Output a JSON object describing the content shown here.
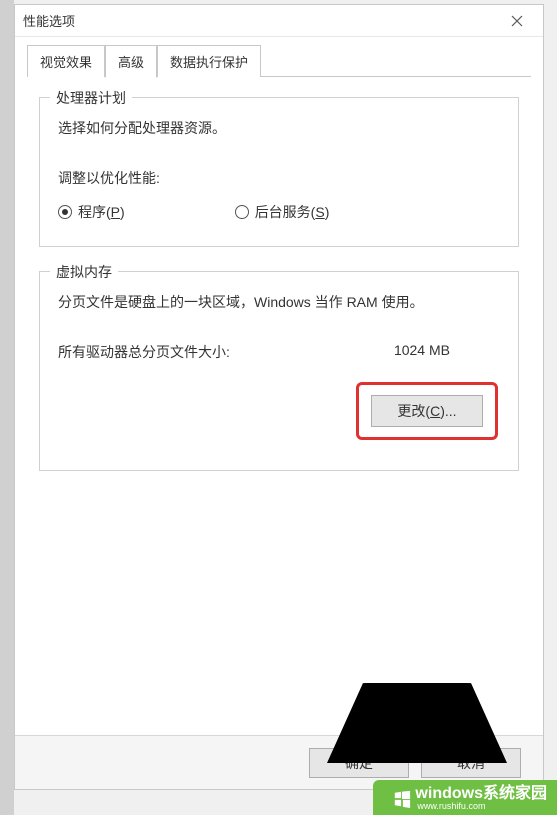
{
  "window": {
    "title": "性能选项"
  },
  "tabs": {
    "visual_effects": "视觉效果",
    "advanced": "高级",
    "dep": "数据执行保护"
  },
  "processor": {
    "group_title": "处理器计划",
    "desc": "选择如何分配处理器资源。",
    "adjust_label": "调整以优化性能:",
    "radio_programs_prefix": "程序(",
    "radio_programs_key": "P",
    "radio_programs_suffix": ")",
    "radio_bg_prefix": "后台服务(",
    "radio_bg_key": "S",
    "radio_bg_suffix": ")"
  },
  "vm": {
    "group_title": "虚拟内存",
    "desc": "分页文件是硬盘上的一块区域，Windows 当作 RAM 使用。",
    "total_label": "所有驱动器总分页文件大小:",
    "total_value": "1024 MB",
    "change_btn_prefix": "更改(",
    "change_btn_key": "C",
    "change_btn_suffix": ")..."
  },
  "footer": {
    "ok": "确定",
    "cancel": "取消"
  },
  "watermark": {
    "brand": "windows",
    "sub": "系统家园",
    "url": "www.rushifu.com"
  }
}
